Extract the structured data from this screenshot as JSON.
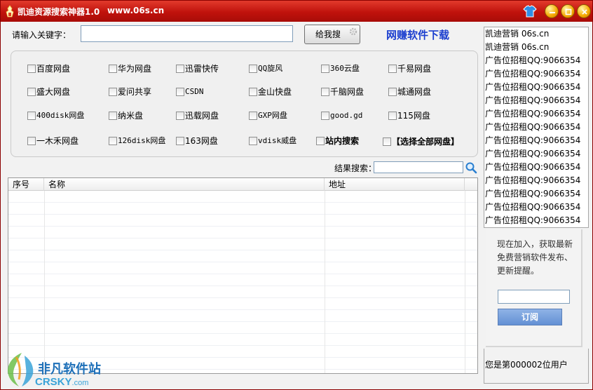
{
  "window": {
    "title": "凯迪资源搜索神器1.0",
    "url": "www.06s.cn"
  },
  "search": {
    "label": "请输入关键字：",
    "value": "",
    "button": "给我搜"
  },
  "promo_link": "网赚软件下载",
  "disks": [
    [
      "百度网盘",
      "华为网盘",
      "迅雷快传",
      "QQ旋风",
      "360云盘",
      "千易网盘"
    ],
    [
      "盛大网盘",
      "爱问共享",
      "CSDN",
      "金山快盘",
      "千脑网盘",
      "城通网盘"
    ],
    [
      "400disk网盘",
      "纳米盘",
      "迅载网盘",
      "GXP网盘",
      "good.gd",
      "115网盘"
    ],
    [
      "一木禾网盘",
      "126disk网盘",
      "163网盘",
      "vdisk威盘",
      "站内搜索",
      "【选择全部网盘】"
    ]
  ],
  "result_search": {
    "label": "结果搜索：",
    "value": ""
  },
  "results": {
    "columns": [
      "序号",
      "名称",
      "地址"
    ],
    "rows": []
  },
  "side_list": [
    "凯迪营销  06s.cn",
    "凯迪营销  06s.cn",
    "广告位招租QQ:9066354",
    "广告位招租QQ:9066354",
    "广告位招租QQ:9066354",
    "广告位招租QQ:9066354",
    "广告位招租QQ:9066354",
    "广告位招租QQ:9066354",
    "广告位招租QQ:9066354",
    "广告位招租QQ:9066354",
    "广告位招租QQ:9066354",
    "广告位招租QQ:9066354",
    "广告位招租QQ:9066354",
    "广告位招租QQ:9066354",
    "广告位招租QQ:9066354"
  ],
  "subscribe": {
    "text": "现在加入，获取最新免费营销软件发布、更新提醒。",
    "email": "",
    "button": "订阅"
  },
  "user_count": "您是第000002位用户",
  "watermark": {
    "line1": "非凡软件站",
    "line2": "CRSKY",
    "line2_suffix": ".com"
  },
  "colors": {
    "titlebar": "#c0120c",
    "promo": "#1c3fcf",
    "subscribe_button": "#6390d4"
  },
  "icons": {
    "app": "app-icon",
    "skin": "skin-shirt-icon",
    "minimize": "minimize-icon",
    "maximize": "maximize-icon",
    "close": "close-icon",
    "search": "search-icon"
  }
}
